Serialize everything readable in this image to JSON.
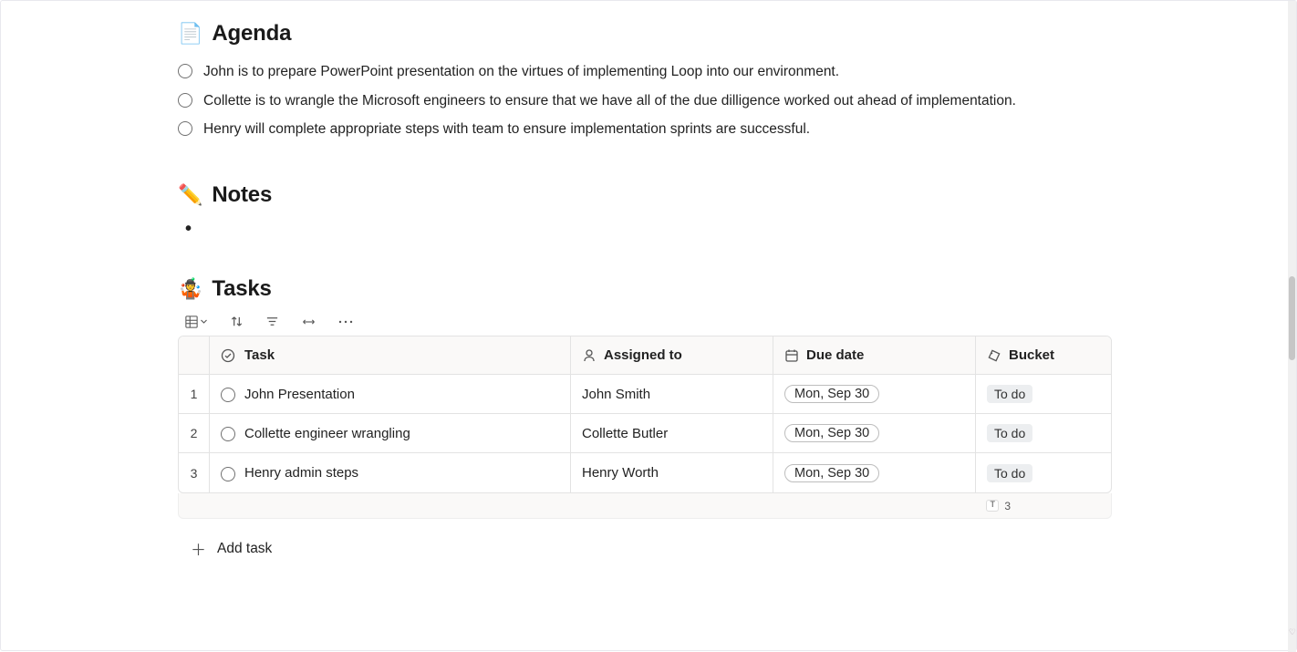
{
  "agenda": {
    "title": "Agenda",
    "icon": "📄",
    "items": [
      "John is to prepare PowerPoint presentation on the virtues of implementing Loop into our environment.",
      "Collette is to wrangle the Microsoft engineers to ensure that we have all of the due dilligence worked out ahead of implementation.",
      "Henry will complete appropriate steps with team to ensure implementation sprints are successful."
    ]
  },
  "notes": {
    "title": "Notes",
    "icon": "✏️"
  },
  "tasks": {
    "title": "Tasks",
    "icon": "🤹",
    "columns": {
      "task": "Task",
      "assigned": "Assigned to",
      "due": "Due date",
      "bucket": "Bucket"
    },
    "rows": [
      {
        "num": "1",
        "task": "John Presentation",
        "assigned": "John Smith",
        "due": "Mon, Sep 30",
        "bucket": "To do"
      },
      {
        "num": "2",
        "task": "Collette engineer wrangling",
        "assigned": "Collette Butler",
        "due": "Mon, Sep 30",
        "bucket": "To do"
      },
      {
        "num": "3",
        "task": "Henry admin steps",
        "assigned": "Henry Worth",
        "due": "Mon, Sep 30",
        "bucket": "To do"
      }
    ],
    "summary_badge": "T",
    "summary_count": "3",
    "add_label": "Add task"
  }
}
